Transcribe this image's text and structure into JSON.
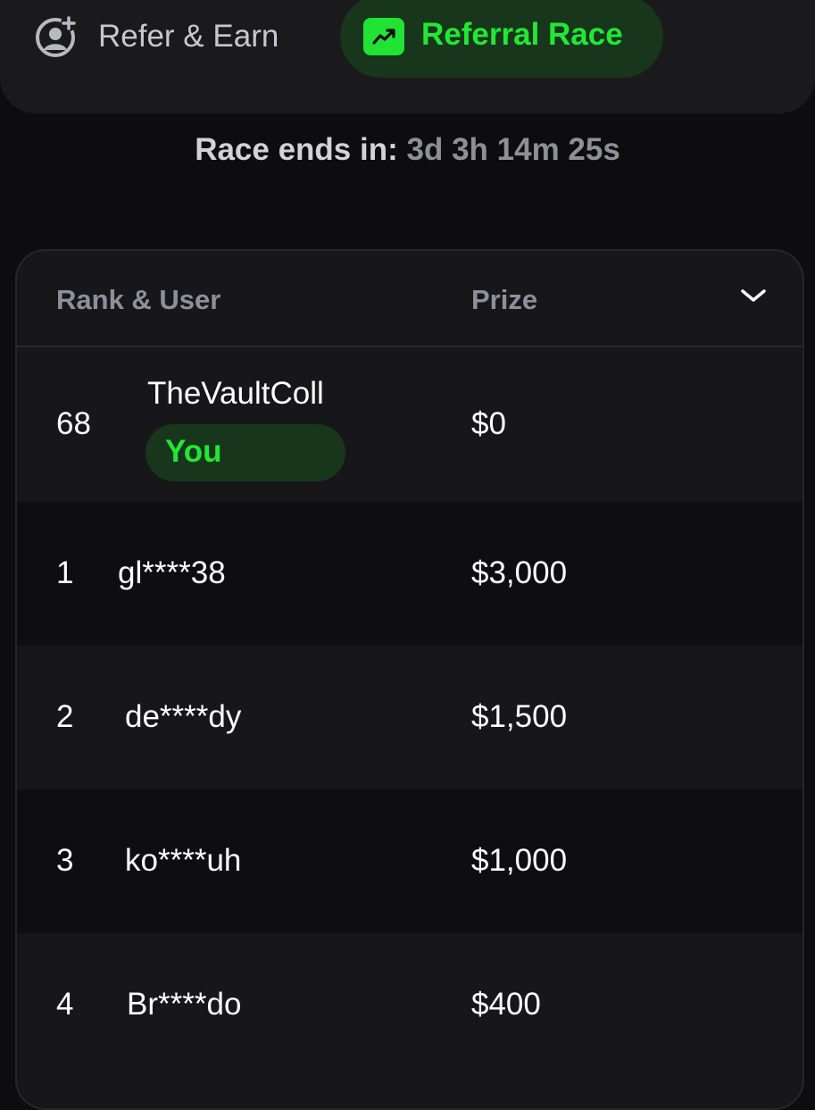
{
  "tabs": {
    "refer_label": "Refer & Earn",
    "race_label": "Referral Race"
  },
  "countdown": {
    "label": "Race ends in:",
    "value": "3d 3h 14m 25s"
  },
  "leaderboard": {
    "headers": {
      "rank_user": "Rank & User",
      "prize": "Prize"
    },
    "current_user": {
      "rank": "68",
      "name": "TheVaultColl",
      "badge": "You",
      "prize": "$0"
    },
    "rows": [
      {
        "rank": "1",
        "user": "gl****38",
        "prize": "$3,000"
      },
      {
        "rank": "2",
        "user": "de****dy",
        "prize": "$1,500"
      },
      {
        "rank": "3",
        "user": "ko****uh",
        "prize": "$1,000"
      },
      {
        "rank": "4",
        "user": "Br****do",
        "prize": "$400"
      }
    ]
  },
  "colors": {
    "accent_green": "#21e834",
    "accent_green_bg": "#17361b",
    "page_bg": "#0d0d0f",
    "row_light": "#17171a",
    "row_dark": "#0e0e10"
  },
  "icons": {
    "refer": "add-user-circle-icon",
    "race": "trending-up-icon",
    "collapse": "chevron-down-icon"
  }
}
